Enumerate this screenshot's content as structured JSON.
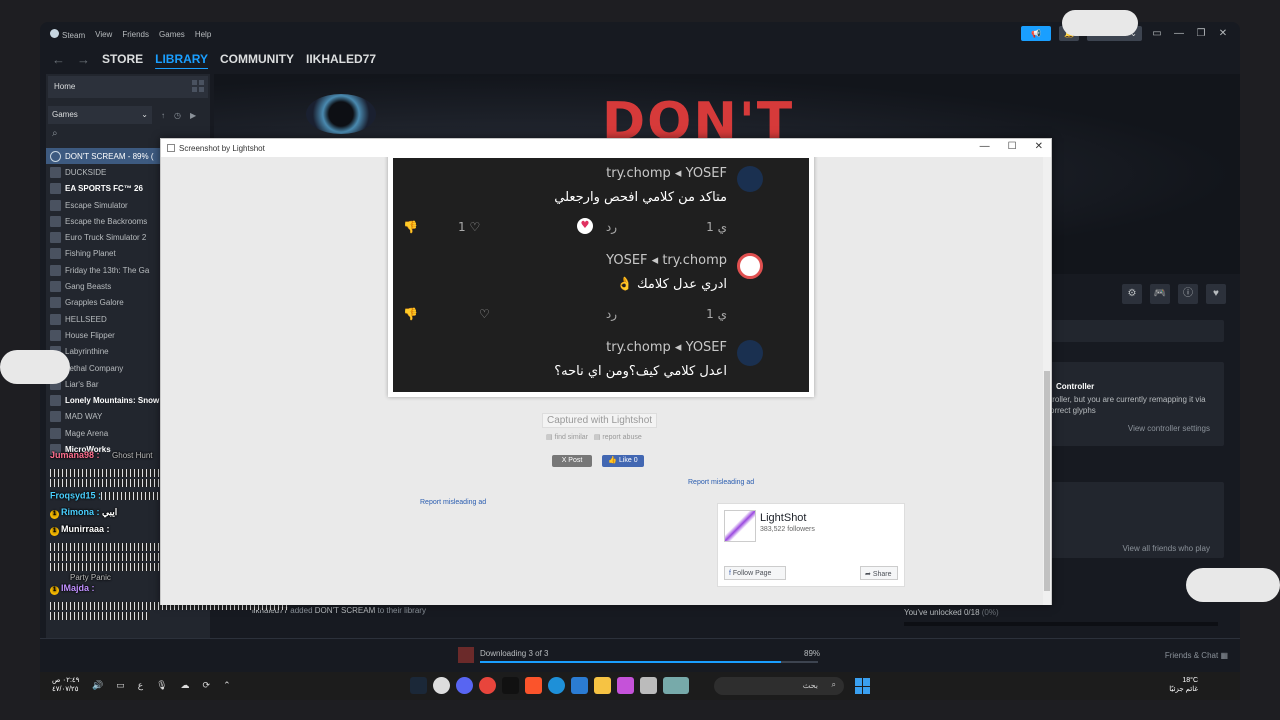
{
  "menubar": {
    "items": [
      "Steam",
      "View",
      "Friends",
      "Games",
      "Help"
    ]
  },
  "nav": {
    "store": "STORE",
    "library": "LIBRARY",
    "community": "COMMUNITY",
    "username": "IIKHALED77"
  },
  "topright": {
    "user": "iikhaled77 ⌄"
  },
  "sidebar": {
    "home": "Home",
    "filter": "Games",
    "games": [
      "DON'T SCREAM - 89% (",
      "DUCKSIDE",
      "EA SPORTS FC™ 26",
      "Escape Simulator",
      "Escape the Backrooms",
      "Euro Truck Simulator 2",
      "Fishing Planet",
      "Friday the 13th: The Ga",
      "Gang Beasts",
      "Grapples Galore",
      "HELLSEED",
      "House Flipper",
      "Labyrinthine",
      "Lethal Company",
      "Liar's Bar",
      "Lonely Mountains: Snow",
      "MAD WAY",
      "Mage Arena",
      "MicroWorks"
    ]
  },
  "hero": {
    "title": "DON'T"
  },
  "controller": {
    "title": "Controller",
    "text": "troller, but you are currently remapping it via orrect glyphs",
    "link": "View controller settings"
  },
  "friends": {
    "link": "View all friends who play"
  },
  "achievements": {
    "text": "You've unlocked 0/18",
    "pct": "(0%)"
  },
  "activity": {
    "user": "iikhaled77",
    "text": "added",
    "game": "DON'T SCREAM",
    "suffix": "to their library"
  },
  "download": {
    "label": "Downloading 3 of 3",
    "pct": "89%",
    "progress": 0.89,
    "friends_chat": "Friends & Chat"
  },
  "chat": {
    "user1": "Jumana98 :",
    "user2": "Froqsyd15 :",
    "user3": "Rimona :",
    "msg3": "ايبي",
    "user4": "Munirraaa :",
    "user5": "IMajda :",
    "hunt": "Ghost Hunt",
    "party": "Party Panic"
  },
  "lightshot": {
    "window_title": "Screenshot by Lightshot",
    "captured": "Captured with Lightshot",
    "find_similar": "find similar",
    "report_abuse": "report abuse",
    "post": "X Post",
    "like": "👍 Like 0",
    "report_ad1": "Report misleading ad",
    "report_ad2": "Report misleading ad",
    "page_name": "LightShot",
    "followers": "383,522 followers",
    "follow_page": "Follow Page",
    "share": "Share"
  },
  "comments": [
    {
      "head": "try.chomp ◂ YOSEF",
      "text": "متاكد من كلامي افحص وارجعلي",
      "likes": "1",
      "reply": "رد",
      "time": "1 ي"
    },
    {
      "head": "YOSEF ◂ try.chomp",
      "text": "ادري عدل كلامك 👌",
      "likes": "",
      "reply": "رد",
      "time": "1 ي"
    },
    {
      "head": "try.chomp ◂ YOSEF",
      "text": "اعدل كلامي كيف؟ومن اي ناحه؟"
    }
  ],
  "taskbar": {
    "time_left": "٠٢:٤٩ ص",
    "date_left": "٤٧/٠٧/٢٥",
    "lang": "ع",
    "search": "بحث",
    "weather": "18°C",
    "weather_desc": "غائم جزئيًا"
  }
}
